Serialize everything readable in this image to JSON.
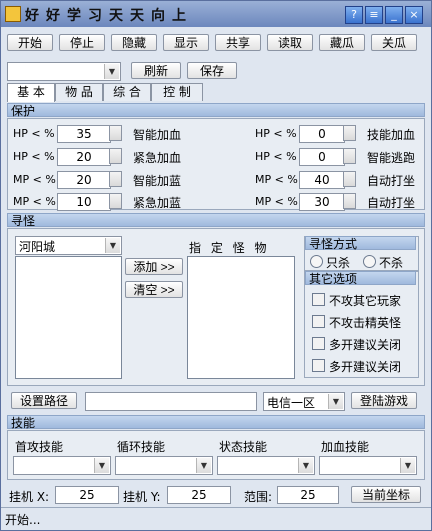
{
  "window": {
    "title": "好好学习天天向上"
  },
  "toolbar": [
    "开始",
    "停止",
    "隐藏",
    "显示",
    "共享",
    "读取",
    "藏瓜",
    "关瓜"
  ],
  "top": {
    "combo_value": "",
    "refresh": "刷新",
    "save": "保存"
  },
  "tabs": [
    "基 本",
    "物 品",
    "综 合",
    "控 制"
  ],
  "protect": {
    "title": "保护",
    "left": [
      {
        "prefix": "HP < %",
        "value": "35",
        "label": "智能加血"
      },
      {
        "prefix": "HP < %",
        "value": "20",
        "label": "紧急加血"
      },
      {
        "prefix": "MP < %",
        "value": "20",
        "label": "智能加蓝"
      },
      {
        "prefix": "MP < %",
        "value": "10",
        "label": "紧急加蓝"
      }
    ],
    "right": [
      {
        "prefix": "HP < %",
        "value": "0",
        "label": "技能加血"
      },
      {
        "prefix": "HP < %",
        "value": "0",
        "label": "智能逃跑"
      },
      {
        "prefix": "MP < %",
        "value": "40",
        "label": "自动打坐"
      },
      {
        "prefix": "MP < %",
        "value": "30",
        "label": "自动打坐"
      }
    ]
  },
  "monster": {
    "title": "寻怪",
    "city": "河阳城",
    "add": "添加 >>",
    "clear": "清空 >>",
    "target_label": "指 定 怪 物",
    "method": {
      "title": "寻怪方式",
      "opt1": "只杀",
      "opt2": "不杀"
    },
    "other": {
      "title": "其它选项",
      "items": [
        "不攻其它玩家",
        "不攻击精英怪",
        "多开建议关闭",
        "多开建议关闭"
      ]
    }
  },
  "path": {
    "set": "设置路径",
    "value": "",
    "server": "电信一区",
    "login": "登陆游戏"
  },
  "skills": {
    "title": "技能",
    "labels": [
      "首攻技能",
      "循环技能",
      "状态技能",
      "加血技能"
    ]
  },
  "coords": {
    "x_label": "挂机 X:",
    "x": "25",
    "y_label": "挂机 Y:",
    "y": "25",
    "range_label": "范围:",
    "range": "25",
    "current": "当前坐标"
  },
  "status": "开始..."
}
